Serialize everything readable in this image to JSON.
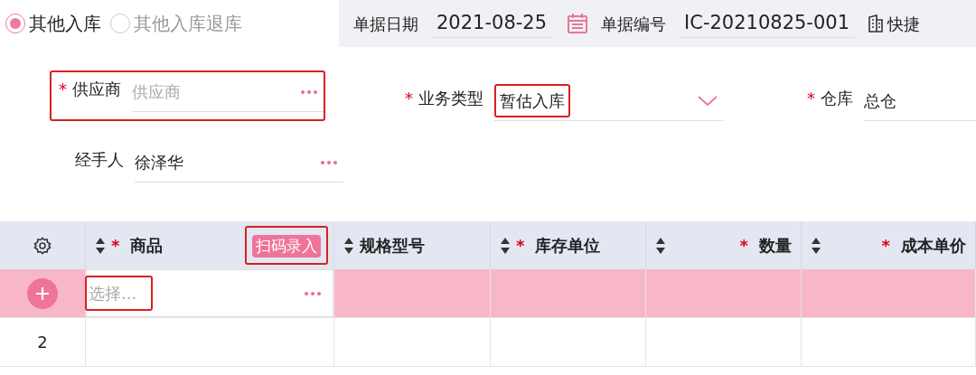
{
  "order_type": [
    {
      "label": "其他入库",
      "selected": true
    },
    {
      "label": "其他入库退库",
      "selected": false
    }
  ],
  "header_fields": [
    {
      "label": "单据日期",
      "value": "2021-08-25",
      "kind": "date"
    },
    {
      "label": "单据编号",
      "value": "IC-20210825-001",
      "kind": "text"
    }
  ],
  "shortcut": {
    "label": "快捷"
  },
  "form_fields": [
    {
      "label": "供应商",
      "required_mark": "*",
      "placeholder": "供应商",
      "kind": "lookup",
      "highlighted": true
    },
    {
      "label": "业务类型",
      "required_mark": "*",
      "value": "暂估入库",
      "kind": "select",
      "highlighted": true
    },
    {
      "label": "仓库",
      "required_mark": "*",
      "value": "总仓",
      "kind": "text"
    },
    {
      "label": "经手人",
      "value": "徐泽华",
      "kind": "lookup"
    }
  ],
  "table": {
    "columns": [
      {
        "kind": "settings"
      },
      {
        "kind": "field",
        "label": "商品",
        "required_mark": "*"
      },
      {
        "kind": "field",
        "label": "规格型号"
      },
      {
        "kind": "field",
        "label": "库存单位",
        "required_mark": "*"
      },
      {
        "kind": "field",
        "label": "数量",
        "required_mark": "*"
      },
      {
        "kind": "field",
        "label": "成本单价",
        "required_mark": "*"
      }
    ],
    "scan_button": {
      "label": "扫码录入",
      "highlighted": true
    },
    "rows": [
      {
        "kind": "new",
        "selected": true,
        "placeholder": "选择...",
        "highlighted": true
      },
      {
        "kind": "numbered",
        "selected": false,
        "number": "2"
      }
    ]
  }
}
